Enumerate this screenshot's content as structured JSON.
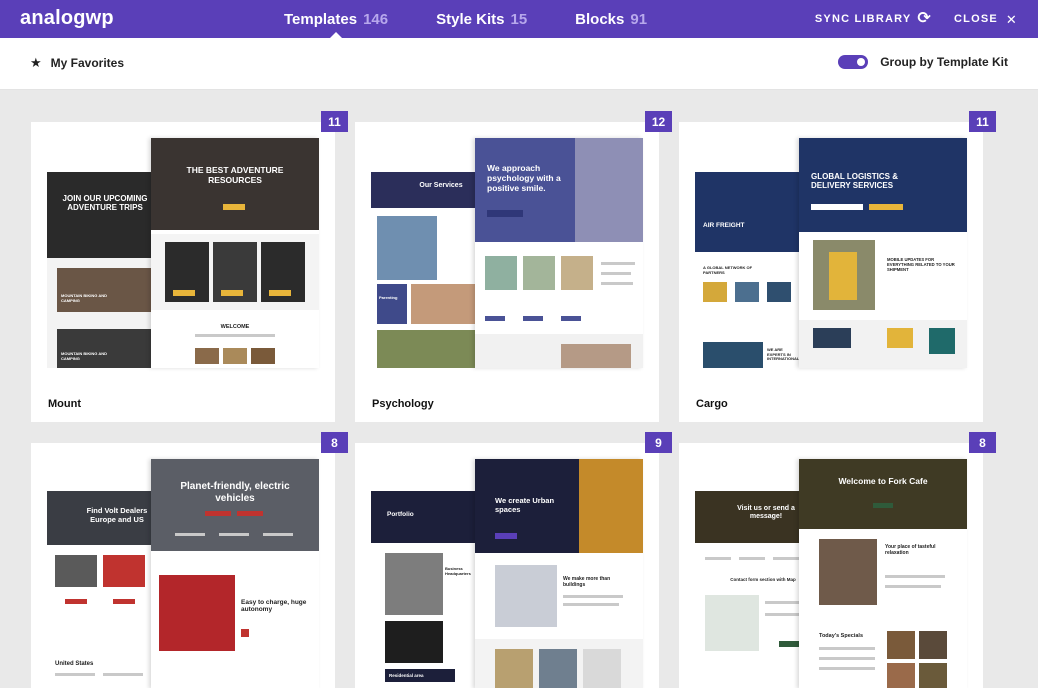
{
  "header": {
    "logo": "analogwp",
    "tabs": [
      {
        "label": "Templates",
        "count": "146"
      },
      {
        "label": "Style Kits",
        "count": "15"
      },
      {
        "label": "Blocks",
        "count": "91"
      }
    ],
    "sync_label": "SYNC LIBRARY",
    "close_label": "CLOSE"
  },
  "toolbar": {
    "favorites_label": "My Favorites",
    "group_label": "Group by Template Kit",
    "group_enabled": true
  },
  "colors": {
    "accent": "#5a3fb8",
    "badge": "#5a3fb8"
  },
  "cards": [
    {
      "name": "Mount",
      "count": "11",
      "texts": {
        "headline": "THE BEST ADVENTURE RESOURCES",
        "sub": "JOIN OUR UPCOMING ADVENTURE TRIPS",
        "trip1": "MOUNTAIN BIKING AND CAMPING",
        "trip2": "MOUNTAIN BIKING AND CAMPING",
        "welcome": "WELCOME"
      }
    },
    {
      "name": "Psychology",
      "count": "12",
      "texts": {
        "headline": "We approach psychology with a positive smile.",
        "services": "Our Services",
        "parenting": "Parenting"
      }
    },
    {
      "name": "Cargo",
      "count": "11",
      "texts": {
        "headline": "GLOBAL LOGISTICS & DELIVERY SERVICES",
        "air": "AIR FREIGHT",
        "network": "A GLOBAL NETWORK OF PARTNERS",
        "mobile": "MOBILE UPDATES FOR EVERYTHING RELATED TO YOUR SHIPMENT",
        "expert": "WE ARE EXPERTS IN INTERNATIONAL"
      }
    },
    {
      "name": "",
      "count": "8",
      "texts": {
        "headline": "Planet-friendly, electric vehicles",
        "dealers": "Find Volt Dealers Europe and US",
        "charge": "Easy to charge, huge autonomy",
        "country": "United States"
      }
    },
    {
      "name": "",
      "count": "9",
      "texts": {
        "headline": "We create Urban spaces",
        "portfolio": "Portfolio",
        "more": "We make more than buildings",
        "business": "Business Headquarters",
        "residential": "Residential area"
      }
    },
    {
      "name": "",
      "count": "8",
      "texts": {
        "headline": "Welcome to Fork Cafe",
        "visit": "Visit us or send a message!",
        "place": "Your place of tasteful relaxation",
        "specials": "Today's Specials",
        "contact": "Contact form section with Map"
      }
    }
  ]
}
